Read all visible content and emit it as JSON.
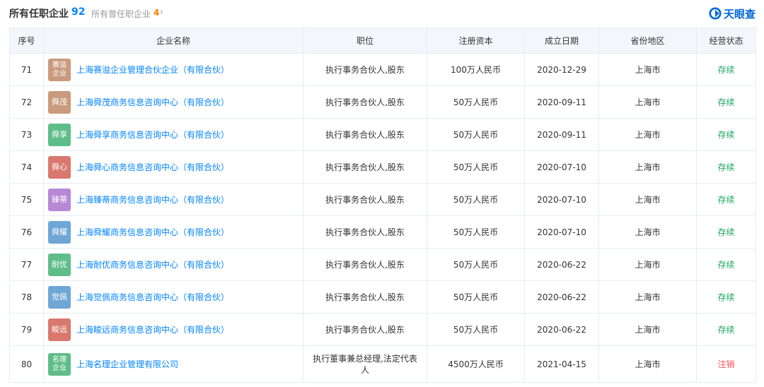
{
  "header": {
    "title": "所有任职企业",
    "title_count": "92",
    "sub_label": "所有曾任职企业",
    "sub_count": "4",
    "sub_chevron": "›",
    "brand": "天眼查",
    "brand_color": "#0067d6"
  },
  "table": {
    "headers": [
      "序号",
      "企业名称",
      "职位",
      "注册资本",
      "成立日期",
      "省份地区",
      "经营状态"
    ],
    "rows": [
      {
        "no": "71",
        "logo": "赛溢企业",
        "logo_color": "#c99a7c",
        "name": "上海赛溢企业管理合伙企业（有限合伙）",
        "position": "执行事务合伙人,股东",
        "capital": "100万人民币",
        "date": "2020-12-29",
        "region": "上海市",
        "status": "存续"
      },
      {
        "no": "72",
        "logo": "舜茂",
        "logo_color": "#c99a7c",
        "name": "上海舜茂商务信息咨询中心（有限合伙）",
        "position": "执行事务合伙人,股东",
        "capital": "50万人民币",
        "date": "2020-09-11",
        "region": "上海市",
        "status": "存续"
      },
      {
        "no": "73",
        "logo": "舜享",
        "logo_color": "#5fbd8a",
        "name": "上海舜享商务信息咨询中心（有限合伙）",
        "position": "执行事务合伙人,股东",
        "capital": "50万人民币",
        "date": "2020-09-11",
        "region": "上海市",
        "status": "存续"
      },
      {
        "no": "74",
        "logo": "舜心",
        "logo_color": "#d9786f",
        "name": "上海舜心商务信息咨询中心（有限合伙）",
        "position": "执行事务合伙人,股东",
        "capital": "50万人民币",
        "date": "2020-07-10",
        "region": "上海市",
        "status": "存续"
      },
      {
        "no": "75",
        "logo": "臻蒂",
        "logo_color": "#b887d6",
        "name": "上海臻蒂商务信息咨询中心（有限合伙）",
        "position": "执行事务合伙人,股东",
        "capital": "50万人民币",
        "date": "2020-07-10",
        "region": "上海市",
        "status": "存续"
      },
      {
        "no": "76",
        "logo": "舜耀",
        "logo_color": "#6ea6d6",
        "name": "上海舜耀商务信息咨询中心（有限合伙）",
        "position": "执行事务合伙人,股东",
        "capital": "50万人民币",
        "date": "2020-07-10",
        "region": "上海市",
        "status": "存续"
      },
      {
        "no": "77",
        "logo": "耐优",
        "logo_color": "#5fbd8a",
        "name": "上海耐优商务信息咨询中心（有限合伙）",
        "position": "执行事务合伙人,股东",
        "capital": "50万人民币",
        "date": "2020-06-22",
        "region": "上海市",
        "status": "存续"
      },
      {
        "no": "78",
        "logo": "觉佩",
        "logo_color": "#6ea6d6",
        "name": "上海觉佩商务信息咨询中心（有限合伙）",
        "position": "执行事务合伙人,股东",
        "capital": "50万人民币",
        "date": "2020-06-22",
        "region": "上海市",
        "status": "存续"
      },
      {
        "no": "79",
        "logo": "睃远",
        "logo_color": "#d9786f",
        "name": "上海睃远商务信息咨询中心（有限合伙）",
        "position": "执行事务合伙人,股东",
        "capital": "50万人民币",
        "date": "2020-06-22",
        "region": "上海市",
        "status": "存续"
      },
      {
        "no": "80",
        "logo": "名理企业",
        "logo_color": "#5fbd8a",
        "name": "上海名理企业管理有限公司",
        "position": "执行董事兼总经理,法定代表人",
        "capital": "4500万人民币",
        "date": "2021-04-15",
        "region": "上海市",
        "status": "注销"
      }
    ]
  },
  "colors": {
    "link": "#0084ff",
    "active": "#19a55d",
    "cancelled": "#ff4d4f",
    "header_bg": "#f3f7fc"
  },
  "icons": {
    "chevron": "chevron-right-icon",
    "brand": "tianyancha-logo-icon"
  }
}
